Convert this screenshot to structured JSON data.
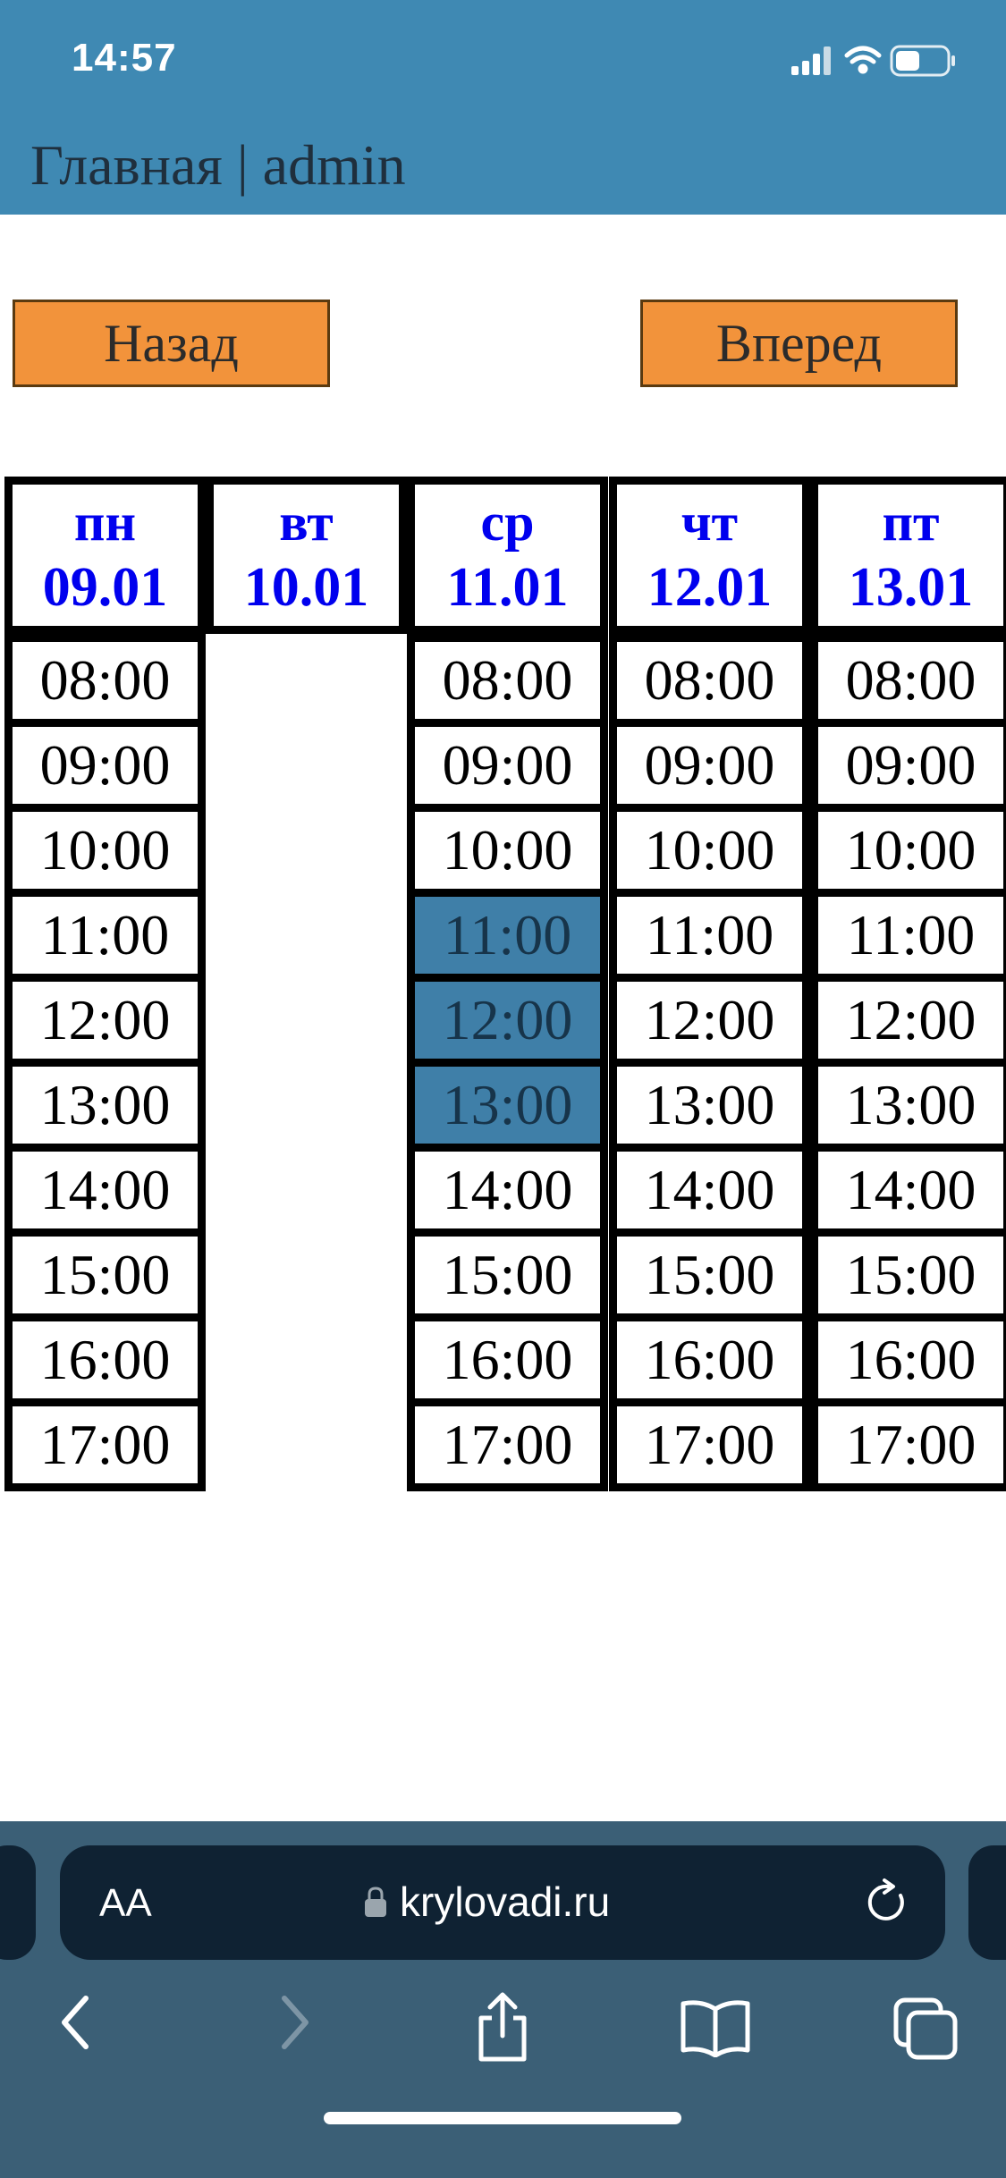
{
  "status_bar": {
    "time": "14:57"
  },
  "header": {
    "title": "Главная | admin"
  },
  "nav": {
    "back_label": "Назад",
    "forward_label": "Вперед"
  },
  "schedule": {
    "days": [
      {
        "name": "пн",
        "date": "09.01",
        "slots": [
          "08:00",
          "09:00",
          "10:00",
          "11:00",
          "12:00",
          "13:00",
          "14:00",
          "15:00",
          "16:00",
          "17:00"
        ],
        "booked": []
      },
      {
        "name": "вт",
        "date": "10.01",
        "slots": [],
        "booked": []
      },
      {
        "name": "ср",
        "date": "11.01",
        "slots": [
          "08:00",
          "09:00",
          "10:00",
          "11:00",
          "12:00",
          "13:00",
          "14:00",
          "15:00",
          "16:00",
          "17:00"
        ],
        "booked": [
          "11:00",
          "12:00",
          "13:00"
        ]
      },
      {
        "name": "чт",
        "date": "12.01",
        "slots": [
          "08:00",
          "09:00",
          "10:00",
          "11:00",
          "12:00",
          "13:00",
          "14:00",
          "15:00",
          "16:00",
          "17:00"
        ],
        "booked": []
      },
      {
        "name": "пт",
        "date": "13.01",
        "slots": [
          "08:00",
          "09:00",
          "10:00",
          "11:00",
          "12:00",
          "13:00",
          "14:00",
          "15:00",
          "16:00",
          "17:00"
        ],
        "booked": []
      }
    ]
  },
  "browser": {
    "text_size_label": "AA",
    "url": "krylovadi.ru"
  },
  "colors": {
    "header_bg": "#3f89b3",
    "button_bg": "#f2933b",
    "booked_bg": "#3f7fa8",
    "day_text": "#0000ee"
  }
}
